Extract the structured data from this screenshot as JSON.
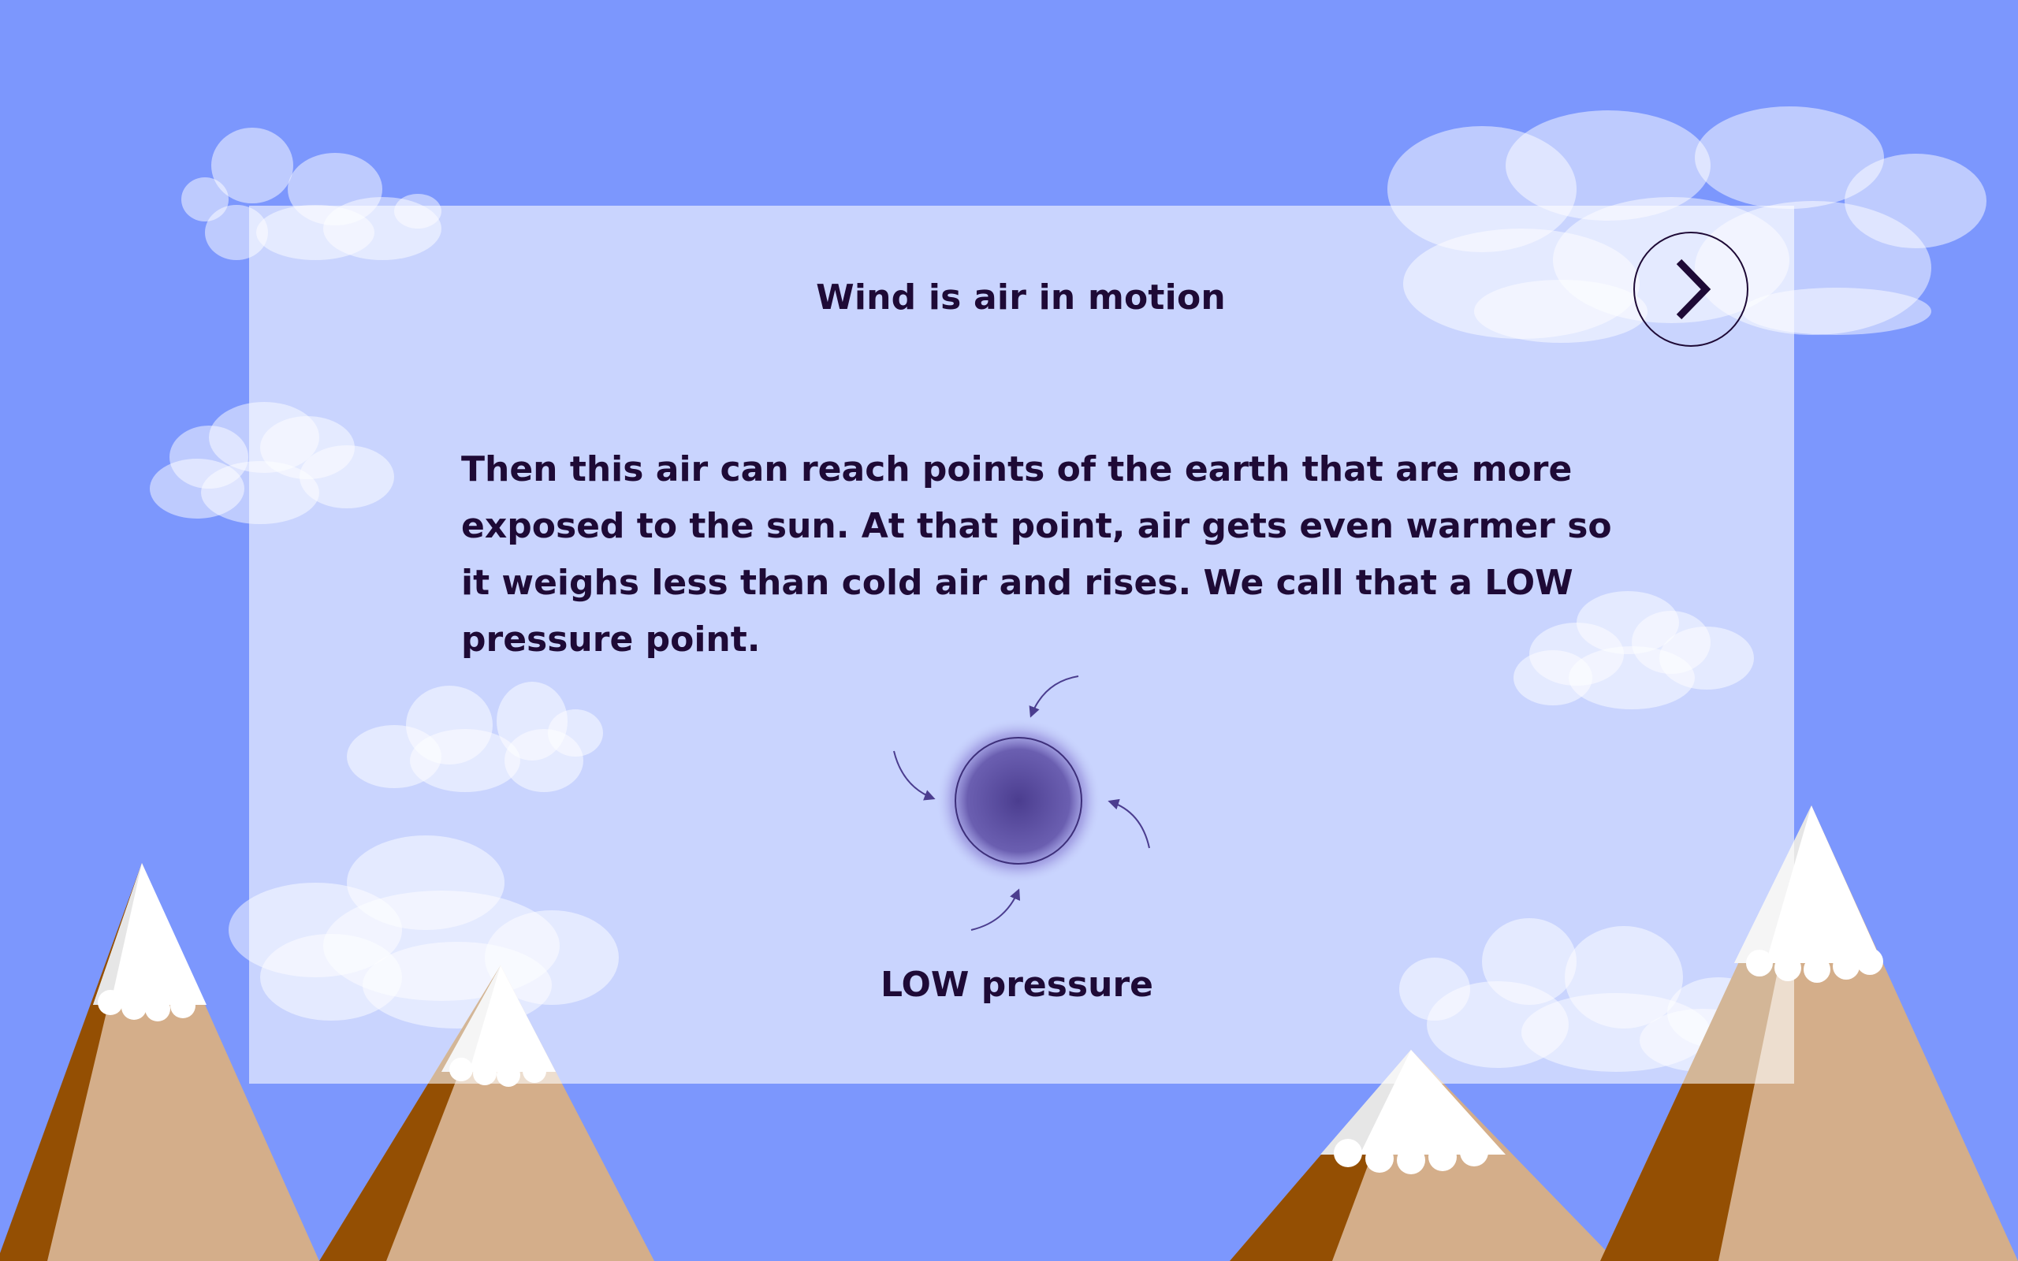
{
  "slide": {
    "title": "Wind is air in motion",
    "body": "Then this air can reach points of the earth that are more exposed to the sun. At that point, air gets even warmer so it weighs less than cold air and rises. We call that a LOW pressure point.",
    "caption": "LOW pressure"
  },
  "controls": {
    "next_icon": "chevron-right-icon"
  },
  "colors": {
    "sky": "#7c97fd",
    "text": "#1e0a36",
    "low_pressure": "#4b3d8f",
    "mountain_light": "#d4ae8a",
    "mountain_dark": "#944f03",
    "snow": "#ffffff"
  }
}
